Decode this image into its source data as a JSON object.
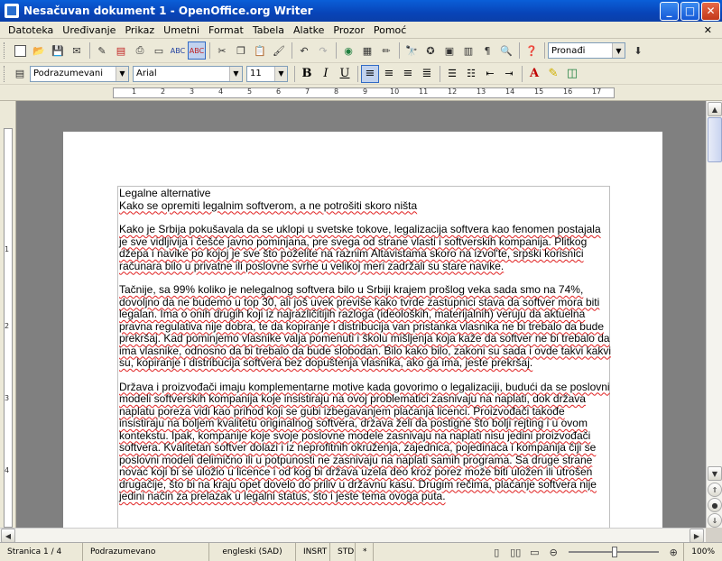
{
  "window": {
    "title": "Nesačuvan dokument 1 - OpenOffice.org Writer",
    "controls": [
      "_",
      "□",
      "✕"
    ]
  },
  "menu": [
    "Datoteka",
    "Uređivanje",
    "Prikaz",
    "Umetni",
    "Format",
    "Tabela",
    "Alatke",
    "Prozor",
    "Pomoć"
  ],
  "toolbar": {
    "find_placeholder": "Pronađi"
  },
  "formatting": {
    "style": "Podrazumevani",
    "font": "Arial",
    "size": "11",
    "bold": "B",
    "italic": "I",
    "underline": "U"
  },
  "ruler": {
    "numbers": [
      "1",
      "2",
      "3",
      "4",
      "5",
      "6",
      "7",
      "8",
      "9",
      "10",
      "11",
      "12",
      "13",
      "14",
      "15",
      "16",
      "17"
    ]
  },
  "vruler": {
    "numbers": [
      "1",
      "2",
      "3",
      "4"
    ]
  },
  "document": {
    "heading": "Legalne alternative",
    "subheading": "Kako se opremiti legalnim softverom, a ne potrošiti skoro ništa",
    "paragraphs": [
      "Kako je Srbija pokušavala da se uklopi u svetske tokove, legalizacija softvera kao fenomen postajala je sve vidljivija i češće javno pominjana, pre svega od strane vlasti i softverskih kompanija. Plitkog džepa i navike po kojoj je sve što poželite na raznim Altavistama skoro na izvol'te, srpski korisnici računara bilo u privatne ili poslovne svrhe u velikoj meri zadržali su stare navike.",
      "Tačnije, sa 99% koliko je nelegalnog softvera bilo u Srbiji krajem prošlog veka sada smo na 74%, dovoljno da ne budemo u top 30, ali još uvek previše kako tvrde zastupnici stava da softver mora biti legalan. Ima o onih drugih koji iz najrazličitijih razloga (ideoloških, materijalnih) veruju da aktuelna pravna regulativa nije dobra, te da kopiranje i distribucija van pristanka vlasnika ne bi trebalo da bude prekršaj. Kad pominjemo vlasnike valja pomenuti i školu mišljenja koja kaže da softver ne bi trebalo da ima vlasnike, odnosno da bi trebalo da bude slobodan. Bilo kako bilo, zakoni su sada i ovde takvi kakvi su, kopiranje i distribucija softvera bez dopuštenja vlasnika, ako ga ima, jeste prekršaj.",
      "Država i proizvođači imaju komplementarne motive kada govorimo o legalizaciji, budući da se poslovni modeli softverskih kompanija koje insistiraju na ovoj problematici zasnivaju na naplati, dok država naplatu poreza vidi kao prihod koji se gubi izbegavanjem plaćanja licenci. Proizvođači takođe insistiraju na boljem kvalitetu originalnog softvera, država želi da postigne što bolji rejting i u ovom kontekstu. Ipak, kompanije koje svoje poslovne modele zasnivaju na naplati nisu jedini proizvođači softvera. Kvalitetan softver dolazi i iz neprofitnih okruženja, zajednica, pojedinaca i kompanija čiji se poslovni modeli delimično ili u potpunosti ne zasnivaju na naplati samih programa. Sa druge strane novac koji bi se uložio u licence i od kog bi država uzela deo kroz porez može biti uložen ili utrošen drugačije, što bi na kraju opet dovelo do priliv u državnu kasu. Drugim rečima, plaćanje softvera nije jedini način za prelazak u legalni status, što i jeste tema ovoga puta."
    ]
  },
  "status": {
    "page": "Stranica 1 / 4",
    "style": "Podrazumevano",
    "language": "engleski (SAD)",
    "insert": "INSRT",
    "selection": "STD",
    "modified": "*",
    "zoom": "100%"
  }
}
